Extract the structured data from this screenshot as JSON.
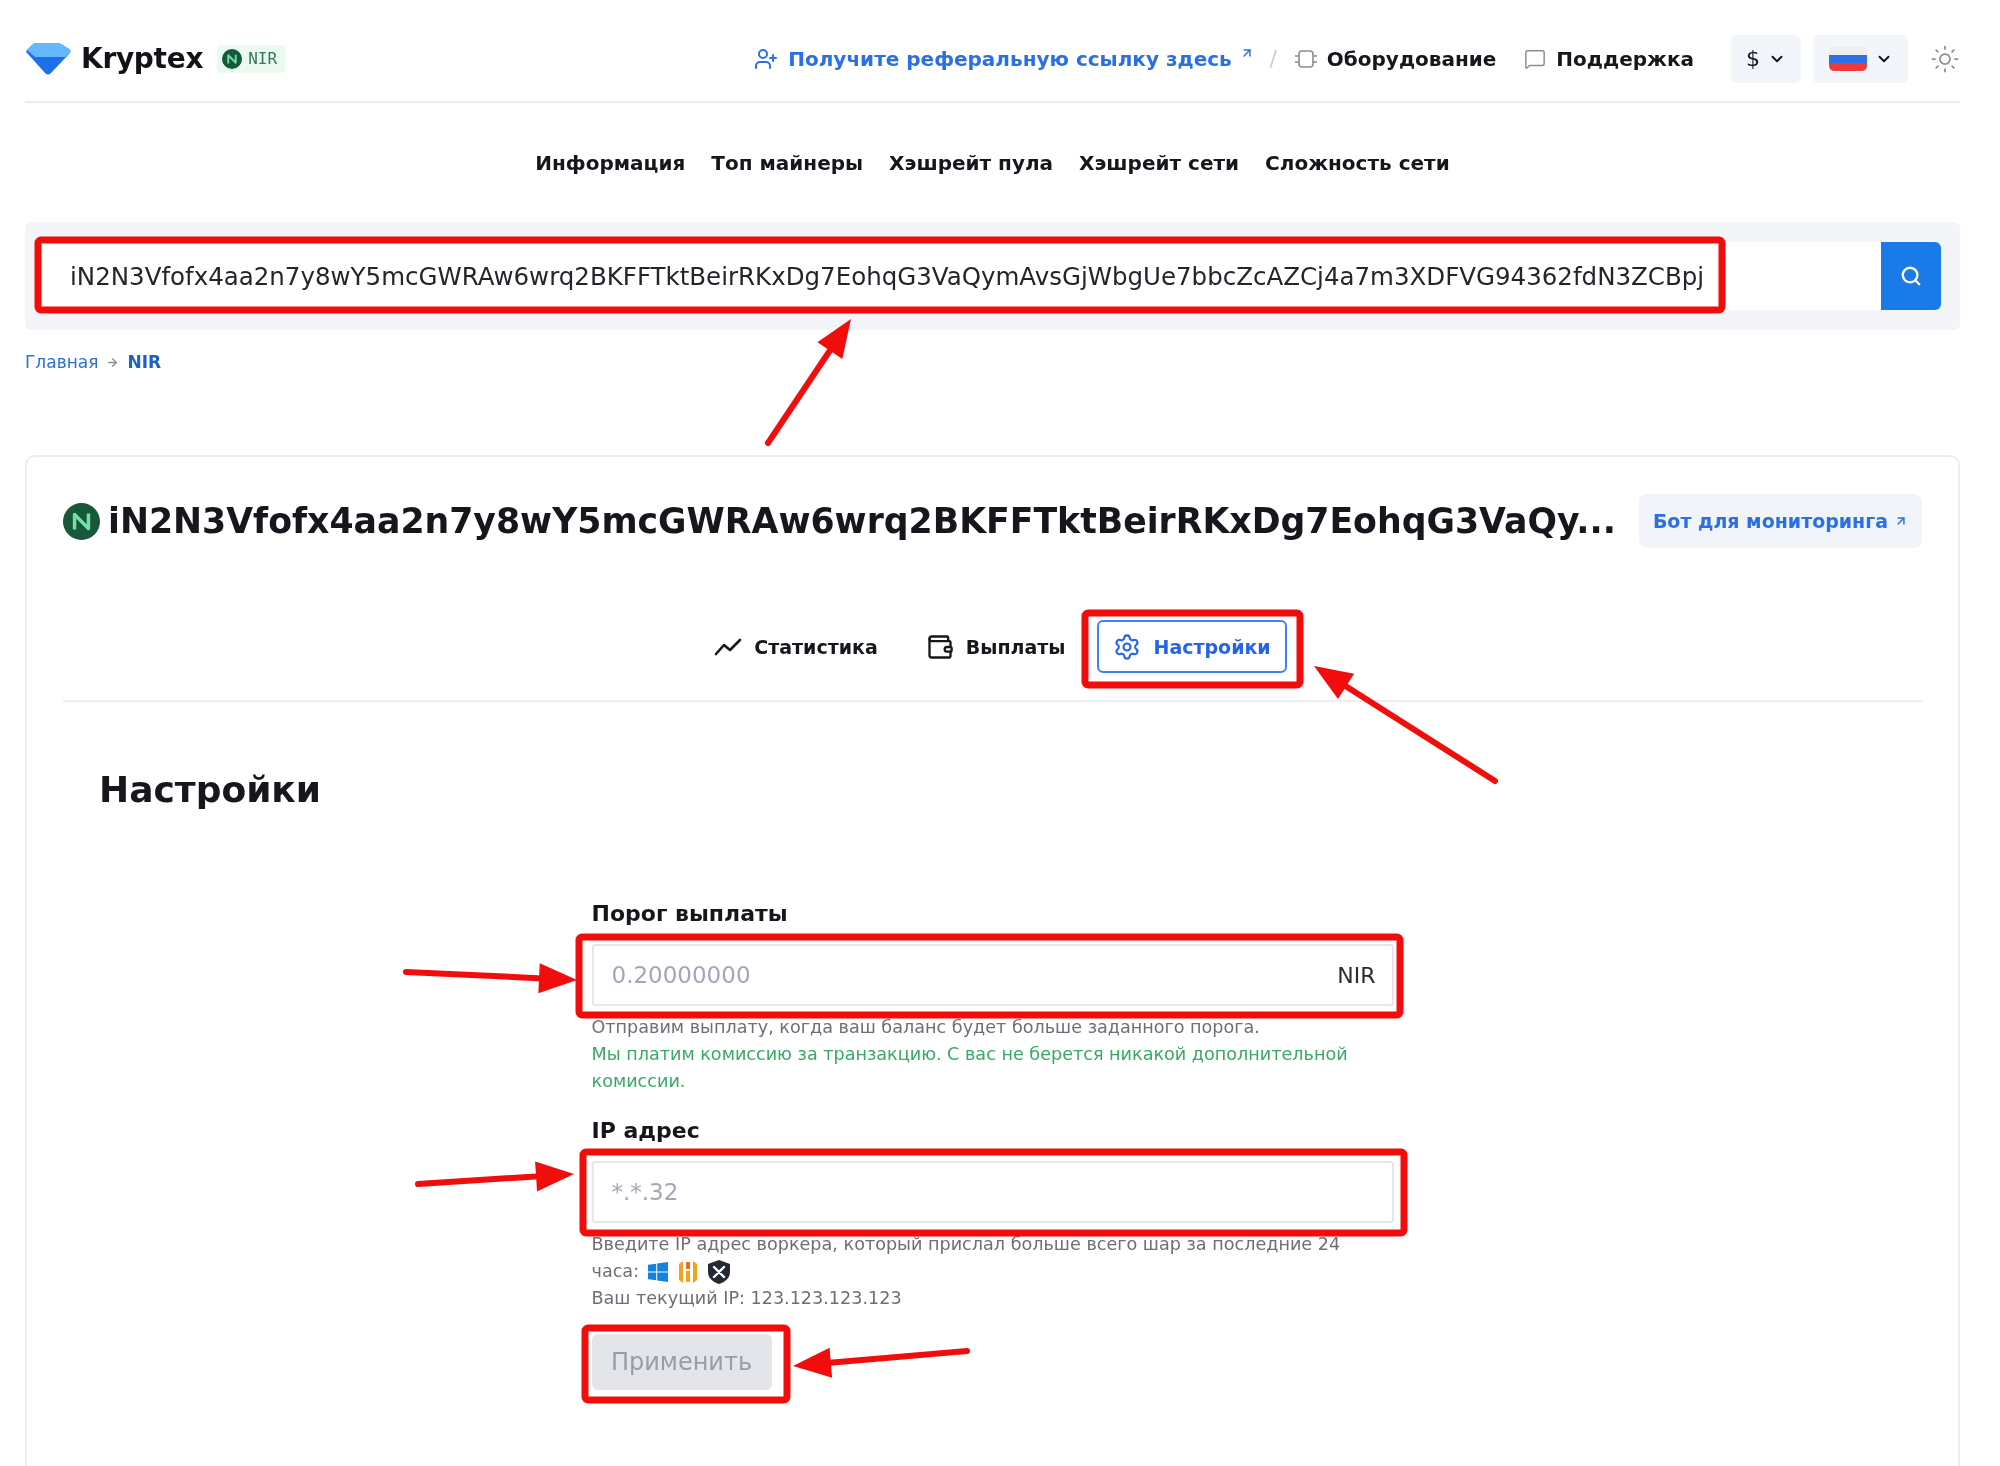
{
  "header": {
    "logo": "Kryptex",
    "coin_badge": "NIR",
    "referral_link": "Получите реферальную ссылку здесь",
    "separator": "/",
    "links": [
      {
        "kind": "hardware",
        "label": "Оборудование"
      },
      {
        "kind": "support",
        "label": "Поддержка"
      }
    ],
    "currency": "$"
  },
  "top_nav": [
    "Информация",
    "Топ майнеры",
    "Хэшрейт пула",
    "Хэшрейт сети",
    "Сложность сети"
  ],
  "search": {
    "value": "iN2N3Vfofx4aa2n7y8wY5mcGWRAw6wrq2BKFFTktBeirRKxDg7EohqG3VaQymAvsGjWbgUe7bbcZcAZCj4a7m3XDFVG94362fdN3ZCBpj"
  },
  "breadcrumb": [
    {
      "label": "Главная",
      "current": false
    },
    {
      "label": "NIR",
      "current": true
    }
  ],
  "wallet": {
    "title": "iN2N3Vfofx4aa2n7y8wY5mcGWRAw6wrq2BKFFTktBeirRKxDg7EohqG3VaQy...",
    "bot_button": "Бот для мониторинга"
  },
  "tabs": [
    {
      "kind": "stats",
      "label": "Статистика",
      "selected": false
    },
    {
      "kind": "payouts",
      "label": "Выплаты",
      "selected": false
    },
    {
      "kind": "settings",
      "label": "Настройки",
      "selected": true
    }
  ],
  "settings": {
    "heading": "Настройки",
    "fields": [
      {
        "label": "Порог выплаты",
        "placeholder": "0.20000000",
        "unit": "NIR",
        "hints": [
          {
            "kind": "info",
            "text": "Отправим выплату, когда ваш баланс будет больше заданного порога."
          },
          {
            "kind": "success",
            "text": "Мы платим комиссию за транзакцию. С вас не берется никакой дополнительной комиссии."
          }
        ]
      },
      {
        "label": "IP адрес",
        "placeholder": "*.*.32",
        "hints": [
          {
            "kind": "info",
            "text": "Введите IP адрес воркера, который прислал больше всего шар за последние 24"
          },
          {
            "kind": "os",
            "text": "часа:"
          },
          {
            "kind": "info",
            "text": "Ваш текущий IP: 123.123.123.123"
          }
        ]
      }
    ],
    "apply_button": {
      "label": "Применить",
      "disabled": true
    }
  }
}
